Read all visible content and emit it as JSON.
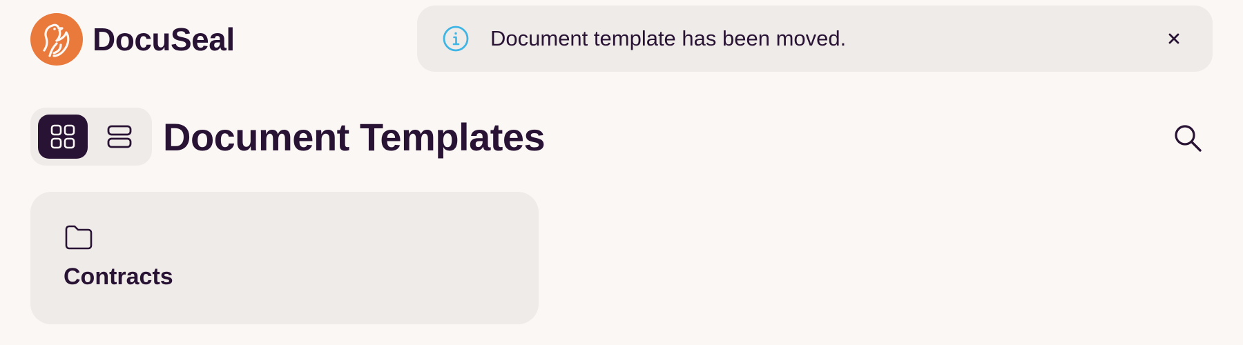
{
  "brand": {
    "name": "DocuSeal",
    "logo_color": "#e97a3b"
  },
  "toast": {
    "message": "Document template has been moved.",
    "info_icon": "info-circle-icon",
    "info_color": "#3fb5e6",
    "close_label": "×"
  },
  "view_toggle": {
    "options": [
      {
        "id": "grid",
        "icon": "grid-icon",
        "active": true
      },
      {
        "id": "list",
        "icon": "list-icon",
        "active": false
      }
    ]
  },
  "header": {
    "title": "Document Templates",
    "search_icon": "search-icon"
  },
  "folders": [
    {
      "name": "Contracts",
      "icon": "folder-icon"
    }
  ],
  "colors": {
    "background": "#fbf7f4",
    "surface": "#efebe8",
    "text": "#291334"
  }
}
